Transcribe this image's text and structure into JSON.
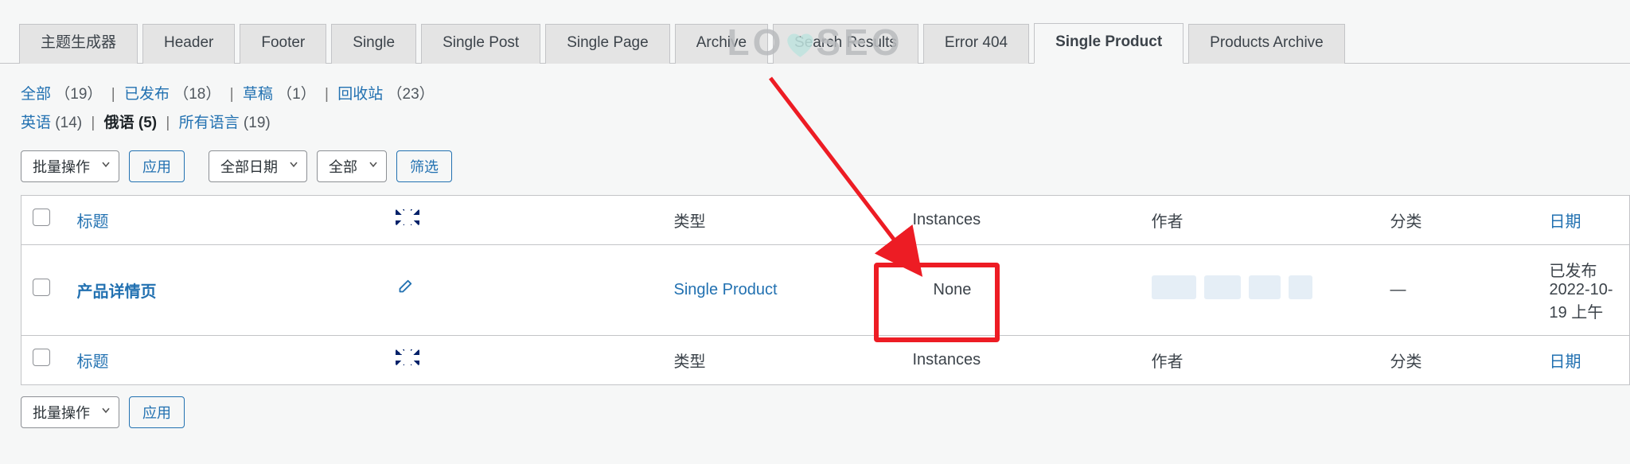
{
  "tabs": [
    {
      "label": "主题生成器",
      "active": false
    },
    {
      "label": "Header",
      "active": false
    },
    {
      "label": "Footer",
      "active": false
    },
    {
      "label": "Single",
      "active": false
    },
    {
      "label": "Single Post",
      "active": false
    },
    {
      "label": "Single Page",
      "active": false
    },
    {
      "label": "Archive",
      "active": false
    },
    {
      "label": "Search Results",
      "active": false
    },
    {
      "label": "Error 404",
      "active": false
    },
    {
      "label": "Single Product",
      "active": true
    },
    {
      "label": "Products Archive",
      "active": false
    }
  ],
  "status_filters": {
    "all_label": "全部",
    "all_count": "（19）",
    "published_label": "已发布",
    "published_count": "（18）",
    "draft_label": "草稿",
    "draft_count": "（1）",
    "trash_label": "回收站",
    "trash_count": "（23）"
  },
  "lang_filters": {
    "english_label": "英语",
    "english_count": "(14)",
    "russian_label": "俄语",
    "russian_count": "(5)",
    "all_label": "所有语言",
    "all_count": "(19)"
  },
  "bulk": {
    "label": "批量操作",
    "apply": "应用"
  },
  "date": {
    "label": "全部日期"
  },
  "all_select": {
    "label": "全部"
  },
  "filter_btn": "筛选",
  "columns": {
    "title": "标题",
    "type": "类型",
    "instances": "Instances",
    "author": "作者",
    "category": "分类",
    "date": "日期"
  },
  "row": {
    "title": "产品详情页",
    "type": "Single Product",
    "instances": "None",
    "category": "—",
    "date_status": "已发布",
    "date_value": "2022-10-19 上午"
  },
  "watermark": {
    "left": "LO",
    "right": "SEO"
  }
}
